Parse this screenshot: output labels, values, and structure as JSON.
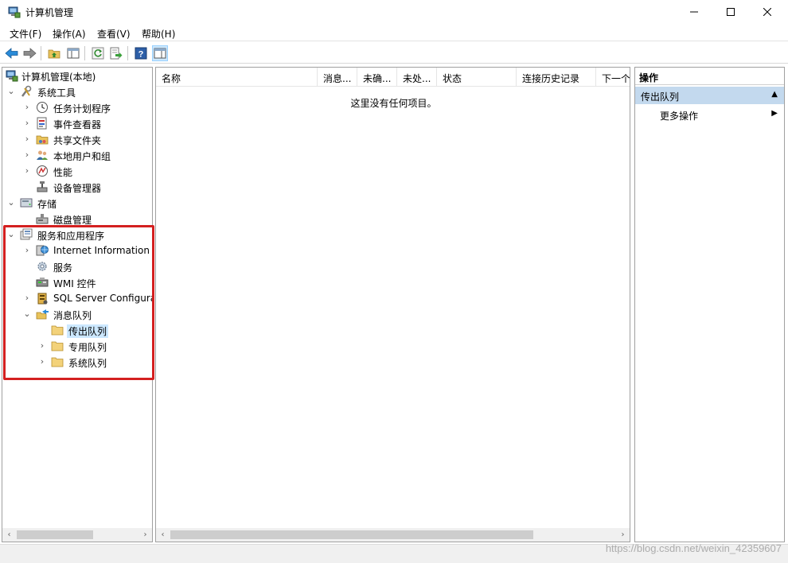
{
  "window": {
    "title": "计算机管理",
    "controls": {
      "minimize": "—",
      "maximize": "☐",
      "close": "✕"
    }
  },
  "menu": {
    "items": [
      "文件(F)",
      "操作(A)",
      "查看(V)",
      "帮助(H)"
    ]
  },
  "toolbar": {
    "buttons": [
      "back-icon",
      "forward-icon",
      "up-folder-icon",
      "show-hide-tree-icon",
      "refresh-icon",
      "export-list-icon",
      "help-icon",
      "show-hide-action-icon"
    ]
  },
  "tree": {
    "root": "计算机管理(本地)",
    "system_tools": "系统工具",
    "task_scheduler": "任务计划程序",
    "event_viewer": "事件查看器",
    "shared_folders": "共享文件夹",
    "local_users": "本地用户和组",
    "performance": "性能",
    "device_manager": "设备管理器",
    "storage": "存储",
    "disk_management": "磁盘管理",
    "services_apps": "服务和应用程序",
    "iis": "Internet Information S",
    "services": "服务",
    "wmi": "WMI 控件",
    "sql": "SQL Server Configura",
    "msmq": "消息队列",
    "outgoing": "传出队列",
    "private": "专用队列",
    "system_queues": "系统队列"
  },
  "list": {
    "columns": [
      "名称",
      "消息...",
      "未确...",
      "未处...",
      "状态",
      "连接历史记录",
      "下一个"
    ],
    "empty_message": "这里没有任何项目。"
  },
  "actions": {
    "header": "操作",
    "section": "传出队列",
    "more": "更多操作"
  },
  "watermark": "https://blog.csdn.net/weixin_42359607",
  "colors": {
    "selection": "#cce8ff",
    "action_section": "#c3d9ee",
    "highlight": "#d42020"
  }
}
